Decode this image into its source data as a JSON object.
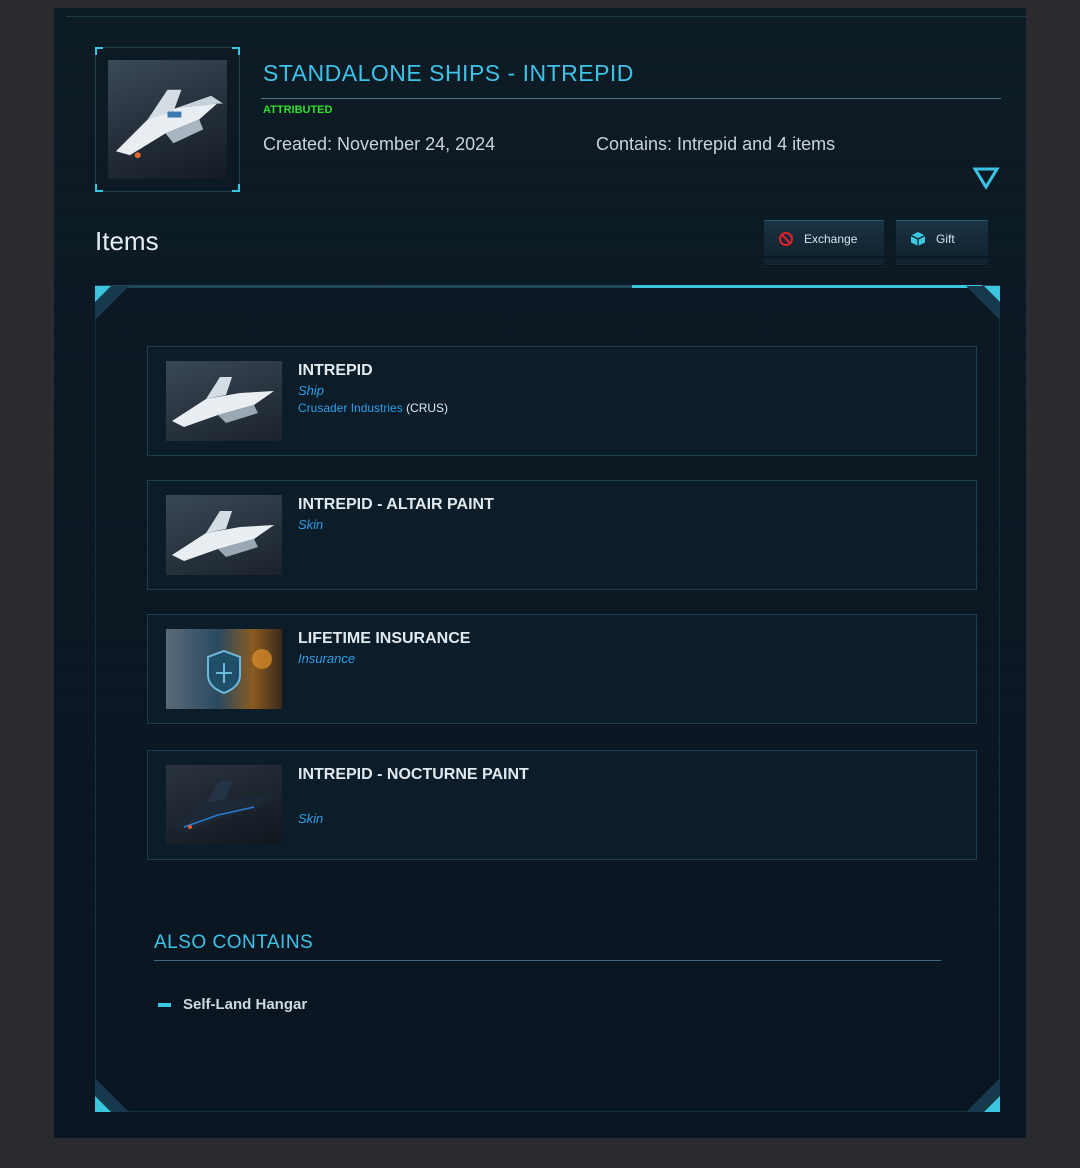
{
  "pledge": {
    "title": "STANDALONE SHIPS - INTREPID",
    "status": "ATTRIBUTED",
    "created": "Created: November 24, 2024",
    "contains": "Contains: Intrepid and 4 items"
  },
  "items_section": {
    "heading": "Items",
    "exchange_label": "Exchange",
    "gift_label": "Gift"
  },
  "items": [
    {
      "name": "INTREPID",
      "type": "Ship",
      "manufacturer": "Crusader Industries",
      "manufacturer_code": "(CRUS)"
    },
    {
      "name": "INTREPID - ALTAIR PAINT",
      "type": "Skin"
    },
    {
      "name": "LIFETIME INSURANCE",
      "type": "Insurance"
    },
    {
      "name": "INTREPID - NOCTURNE PAINT",
      "type": "Skin"
    }
  ],
  "also_contains": {
    "heading": "ALSO CONTAINS",
    "entries": [
      "Self-Land Hangar"
    ]
  },
  "colors": {
    "accent": "#3ec3e8",
    "status_green": "#2ee02e",
    "type_blue": "#2a9ee8",
    "panel_bg": "#0a1822"
  },
  "icons": [
    "expand-triangle-icon",
    "exchange-icon",
    "gift-icon",
    "list-dash-icon"
  ]
}
